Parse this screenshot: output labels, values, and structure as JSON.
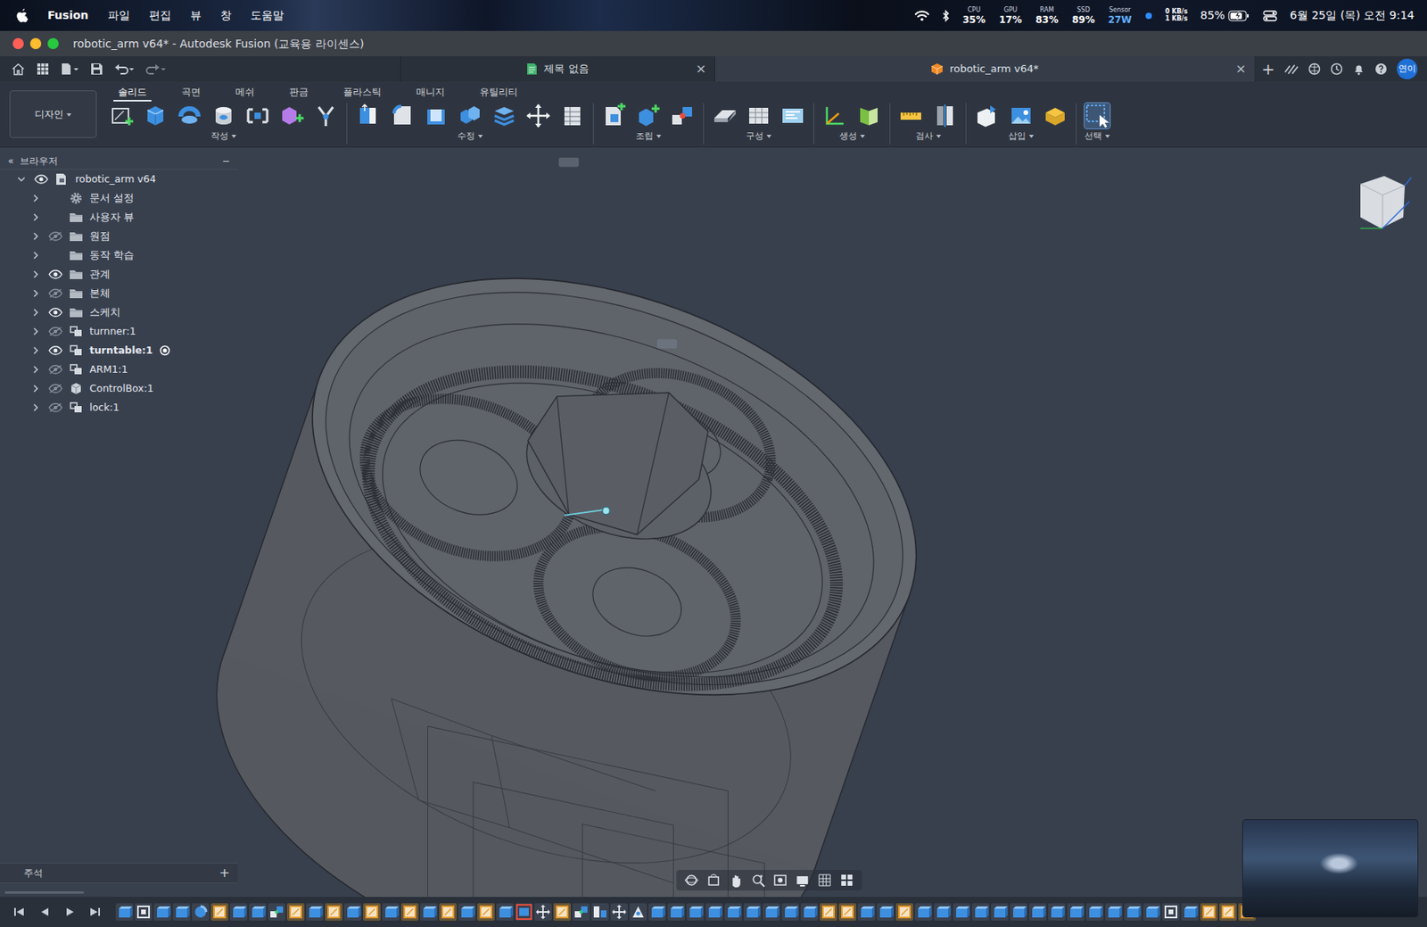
{
  "menubar": {
    "app": "Fusion",
    "menus": [
      "파일",
      "편집",
      "뷰",
      "창",
      "도움말"
    ],
    "meters": [
      {
        "label": "CPU",
        "value": "35%"
      },
      {
        "label": "GPU",
        "value": "17%"
      },
      {
        "label": "RAM",
        "value": "83%"
      },
      {
        "label": "SSD",
        "value": "89%"
      },
      {
        "label": "Sensor",
        "value": "27W"
      }
    ],
    "network": {
      "up": "0 KB/s",
      "down": "1 KB/s"
    },
    "battery": {
      "reading": "85%",
      "level": 0.85
    },
    "clock": "6월 25일 (목) 오전 9:14"
  },
  "window": {
    "title": "robotic_arm v64* - Autodesk Fusion (교육용 라이센스)"
  },
  "doc_tabs": [
    {
      "label": "제목 없음",
      "selected": false,
      "close": "×"
    },
    {
      "label": "robotic_arm v64*",
      "selected": true,
      "close": "×"
    }
  ],
  "new_tab": "+",
  "user": {
    "initials": "연이"
  },
  "workspace": {
    "label": "디자인"
  },
  "toolbar_tabs": [
    {
      "label": "솔리드",
      "selected": true
    },
    {
      "label": "곡면",
      "selected": false
    },
    {
      "label": "메쉬",
      "selected": false
    },
    {
      "label": "판금",
      "selected": false
    },
    {
      "label": "플라스틱",
      "selected": false
    },
    {
      "label": "매니지",
      "selected": false
    },
    {
      "label": "유틸리티",
      "selected": false
    }
  ],
  "tool_groups": [
    {
      "label": "작성",
      "highlighted": false
    },
    {
      "label": "수정",
      "highlighted": false
    },
    {
      "label": "조립",
      "highlighted": false
    },
    {
      "label": "구성",
      "highlighted": false
    },
    {
      "label": "생성",
      "highlighted": false
    },
    {
      "label": "검사",
      "highlighted": false
    },
    {
      "label": "삽입",
      "highlighted": false
    },
    {
      "label": "선택",
      "highlighted": true
    }
  ],
  "browser": {
    "title": "브라우저",
    "collapse": "«",
    "minimize": "−",
    "root": {
      "label": "robotic_arm v64",
      "kind": "root",
      "expanded": true,
      "visibility": "shown",
      "active": false,
      "children": [
        {
          "label": "문서 설정",
          "kind": "settings",
          "expanded": false,
          "visibility": "none",
          "active": false
        },
        {
          "label": "사용자 뷰",
          "kind": "folder",
          "expanded": false,
          "visibility": "none",
          "active": false
        },
        {
          "label": "원점",
          "kind": "folder",
          "expanded": false,
          "visibility": "hidden",
          "active": false
        },
        {
          "label": "동작 학습",
          "kind": "folder",
          "expanded": false,
          "visibility": "none",
          "active": false
        },
        {
          "label": "관계",
          "kind": "folder",
          "expanded": false,
          "visibility": "shown",
          "active": false
        },
        {
          "label": "본체",
          "kind": "folder",
          "expanded": false,
          "visibility": "hidden",
          "active": false
        },
        {
          "label": "스케치",
          "kind": "folder",
          "expanded": false,
          "visibility": "shown",
          "active": false
        },
        {
          "label": "turnner:1",
          "kind": "component",
          "expanded": false,
          "visibility": "hidden",
          "active": false
        },
        {
          "label": "turntable:1",
          "kind": "component",
          "expanded": false,
          "visibility": "shown",
          "active": true
        },
        {
          "label": "ARM1:1",
          "kind": "component",
          "expanded": false,
          "visibility": "hidden",
          "active": false
        },
        {
          "label": "ControlBox:1",
          "kind": "body",
          "expanded": false,
          "visibility": "hidden",
          "active": false
        },
        {
          "label": "lock:1",
          "kind": "component",
          "expanded": false,
          "visibility": "hidden",
          "active": false
        }
      ]
    }
  },
  "annotations": {
    "title": "주석",
    "add": "+"
  },
  "timeline": {
    "features": [
      {
        "kind": "extrude"
      },
      {
        "kind": "component"
      },
      {
        "kind": "extrude"
      },
      {
        "kind": "extrude"
      },
      {
        "kind": "revolve"
      },
      {
        "kind": "sketch"
      },
      {
        "kind": "extrude"
      },
      {
        "kind": "extrude"
      },
      {
        "kind": "joint"
      },
      {
        "kind": "sketch"
      },
      {
        "kind": "extrude"
      },
      {
        "kind": "sketch"
      },
      {
        "kind": "extrude"
      },
      {
        "kind": "sketch"
      },
      {
        "kind": "extrude"
      },
      {
        "kind": "sketch"
      },
      {
        "kind": "extrude"
      },
      {
        "kind": "sketch"
      },
      {
        "kind": "extrude"
      },
      {
        "kind": "sketch"
      },
      {
        "kind": "extrude"
      },
      {
        "kind": "warning"
      },
      {
        "kind": "move"
      },
      {
        "kind": "sketch"
      },
      {
        "kind": "joint"
      },
      {
        "kind": "align"
      },
      {
        "kind": "move"
      },
      {
        "kind": "rigid"
      },
      {
        "kind": "extrude"
      },
      {
        "kind": "extrude"
      },
      {
        "kind": "extrude"
      },
      {
        "kind": "extrude"
      },
      {
        "kind": "extrude"
      },
      {
        "kind": "extrude"
      },
      {
        "kind": "extrude"
      },
      {
        "kind": "extrude"
      },
      {
        "kind": "extrude"
      },
      {
        "kind": "sketch"
      },
      {
        "kind": "sketch"
      },
      {
        "kind": "extrude"
      },
      {
        "kind": "extrude"
      },
      {
        "kind": "sketch"
      },
      {
        "kind": "extrude"
      },
      {
        "kind": "extrude"
      },
      {
        "kind": "extrude"
      },
      {
        "kind": "extrude"
      },
      {
        "kind": "extrude"
      },
      {
        "kind": "extrude"
      },
      {
        "kind": "extrude"
      },
      {
        "kind": "extrude"
      },
      {
        "kind": "extrude"
      },
      {
        "kind": "extrude"
      },
      {
        "kind": "extrude"
      },
      {
        "kind": "extrude"
      },
      {
        "kind": "extrude"
      },
      {
        "kind": "component"
      },
      {
        "kind": "extrude"
      },
      {
        "kind": "sketch"
      },
      {
        "kind": "sketch"
      },
      {
        "kind": "sketch"
      }
    ]
  }
}
